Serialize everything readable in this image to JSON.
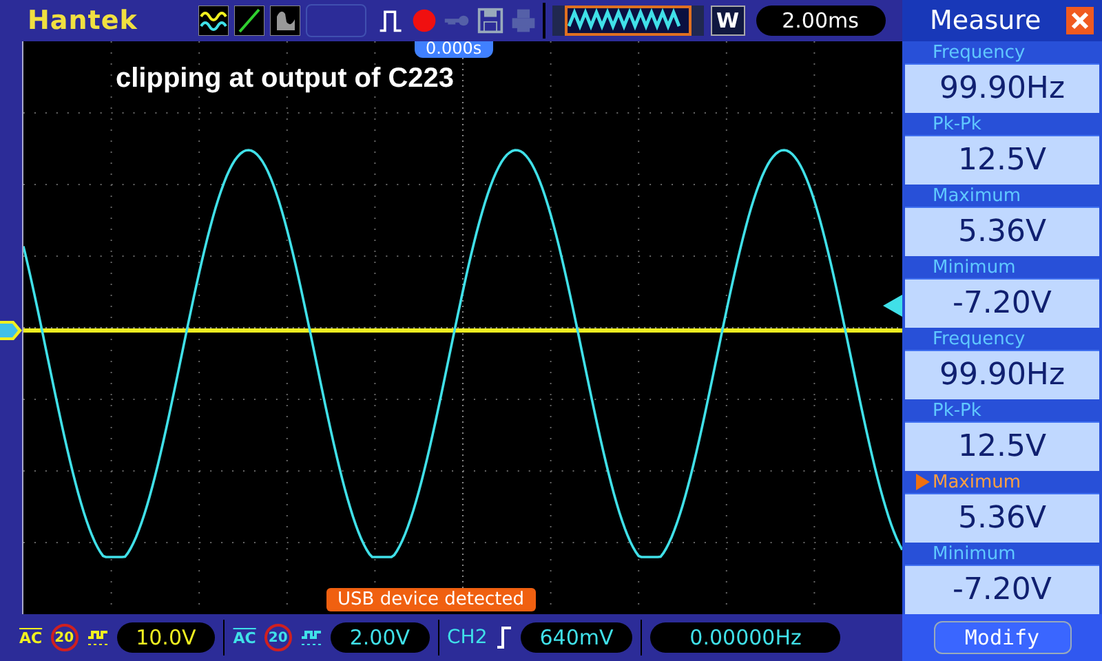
{
  "header": {
    "brand": "Hantek",
    "mode_key": "W",
    "timebase": "2.00ms",
    "trigger_position": "0.000s"
  },
  "screen": {
    "annotation": "clipping at output of C223",
    "notification": "USB device detected"
  },
  "measure": {
    "title": "Measure",
    "items": [
      {
        "label": "Frequency",
        "value": "99.90Hz",
        "selected": false
      },
      {
        "label": "Pk-Pk",
        "value": "12.5V",
        "selected": false
      },
      {
        "label": "Maximum",
        "value": "5.36V",
        "selected": false
      },
      {
        "label": "Minimum",
        "value": "-7.20V",
        "selected": false
      },
      {
        "label": "Frequency",
        "value": "99.90Hz",
        "selected": false
      },
      {
        "label": "Pk-Pk",
        "value": "12.5V",
        "selected": false
      },
      {
        "label": "Maximum",
        "value": "5.36V",
        "selected": true
      },
      {
        "label": "Minimum",
        "value": "-7.20V",
        "selected": false
      }
    ],
    "button": "Modify"
  },
  "channels": [
    {
      "coupling": "AC",
      "bw_limit": "20",
      "scale": "10.0V",
      "color": "#f0f020"
    },
    {
      "coupling": "AC",
      "bw_limit": "20",
      "scale": "2.00V",
      "color": "#40e0e8"
    }
  ],
  "trigger": {
    "source": "CH2",
    "level": "640mV"
  },
  "frequency": "0.00000Hz"
}
